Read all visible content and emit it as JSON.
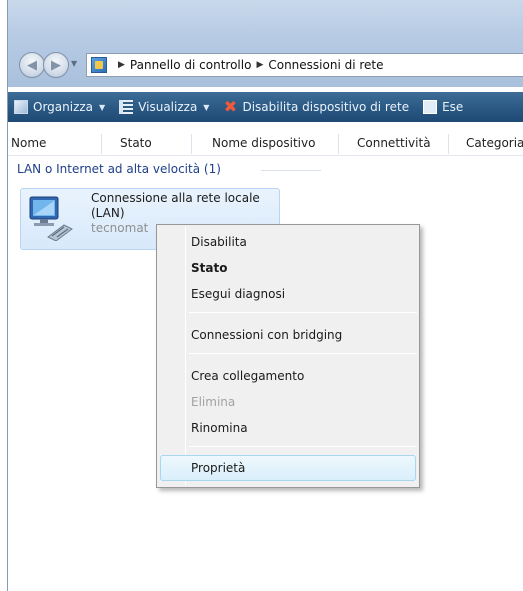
{
  "address": {
    "crumbs": [
      "Pannello di controllo",
      "Connessioni di rete"
    ]
  },
  "toolbar": {
    "organize": "Organizza",
    "view": "Visualizza",
    "disable_device": "Disabilita dispositivo di rete",
    "execute": "Ese"
  },
  "columns": [
    "Nome",
    "Stato",
    "Nome dispositivo",
    "Connettività",
    "Categoria"
  ],
  "group": {
    "label": "LAN o Internet ad alta velocità (1)"
  },
  "item": {
    "name_line1": "Connessione alla rete locale",
    "name_line2": "(LAN)",
    "sub": "tecnomat"
  },
  "menu": {
    "disable": "Disabilita",
    "status": "Stato",
    "diagnose": "Esegui diagnosi",
    "bridge": "Connessioni con bridging",
    "shortcut": "Crea collegamento",
    "delete": "Elimina",
    "rename": "Rinomina",
    "properties": "Proprietà"
  },
  "colors": {
    "toolbar": "#2b5a85",
    "selection": "#d8e9fb",
    "group_text": "#1e3f8a"
  }
}
